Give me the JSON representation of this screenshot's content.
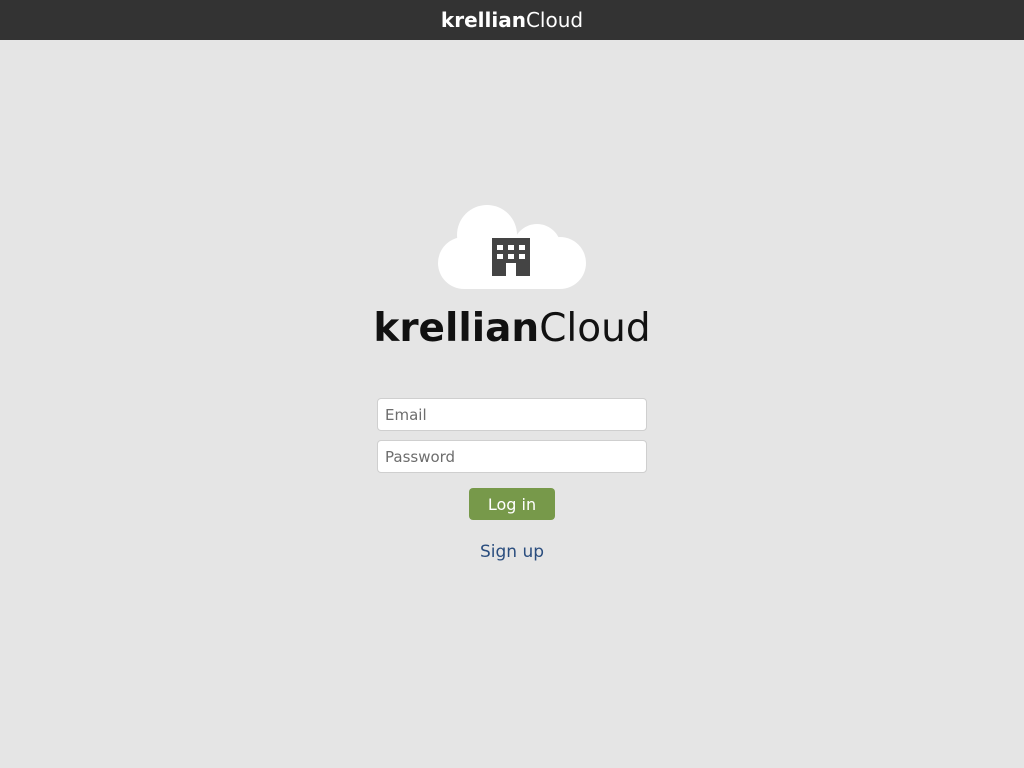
{
  "topbar": {
    "brand_bold": "krellian",
    "brand_light": "Cloud"
  },
  "logo": {
    "icon": "building-icon",
    "brand_bold": "krellian",
    "brand_light": "Cloud"
  },
  "form": {
    "email_placeholder": "Email",
    "email_value": "",
    "password_placeholder": "Password",
    "password_value": "",
    "login_label": "Log in",
    "signup_label": "Sign up"
  },
  "colors": {
    "topbar": "#333333",
    "background": "#e5e5e5",
    "login_button": "#77994a",
    "signup_link": "#2a4d7e",
    "icon": "#444444"
  }
}
